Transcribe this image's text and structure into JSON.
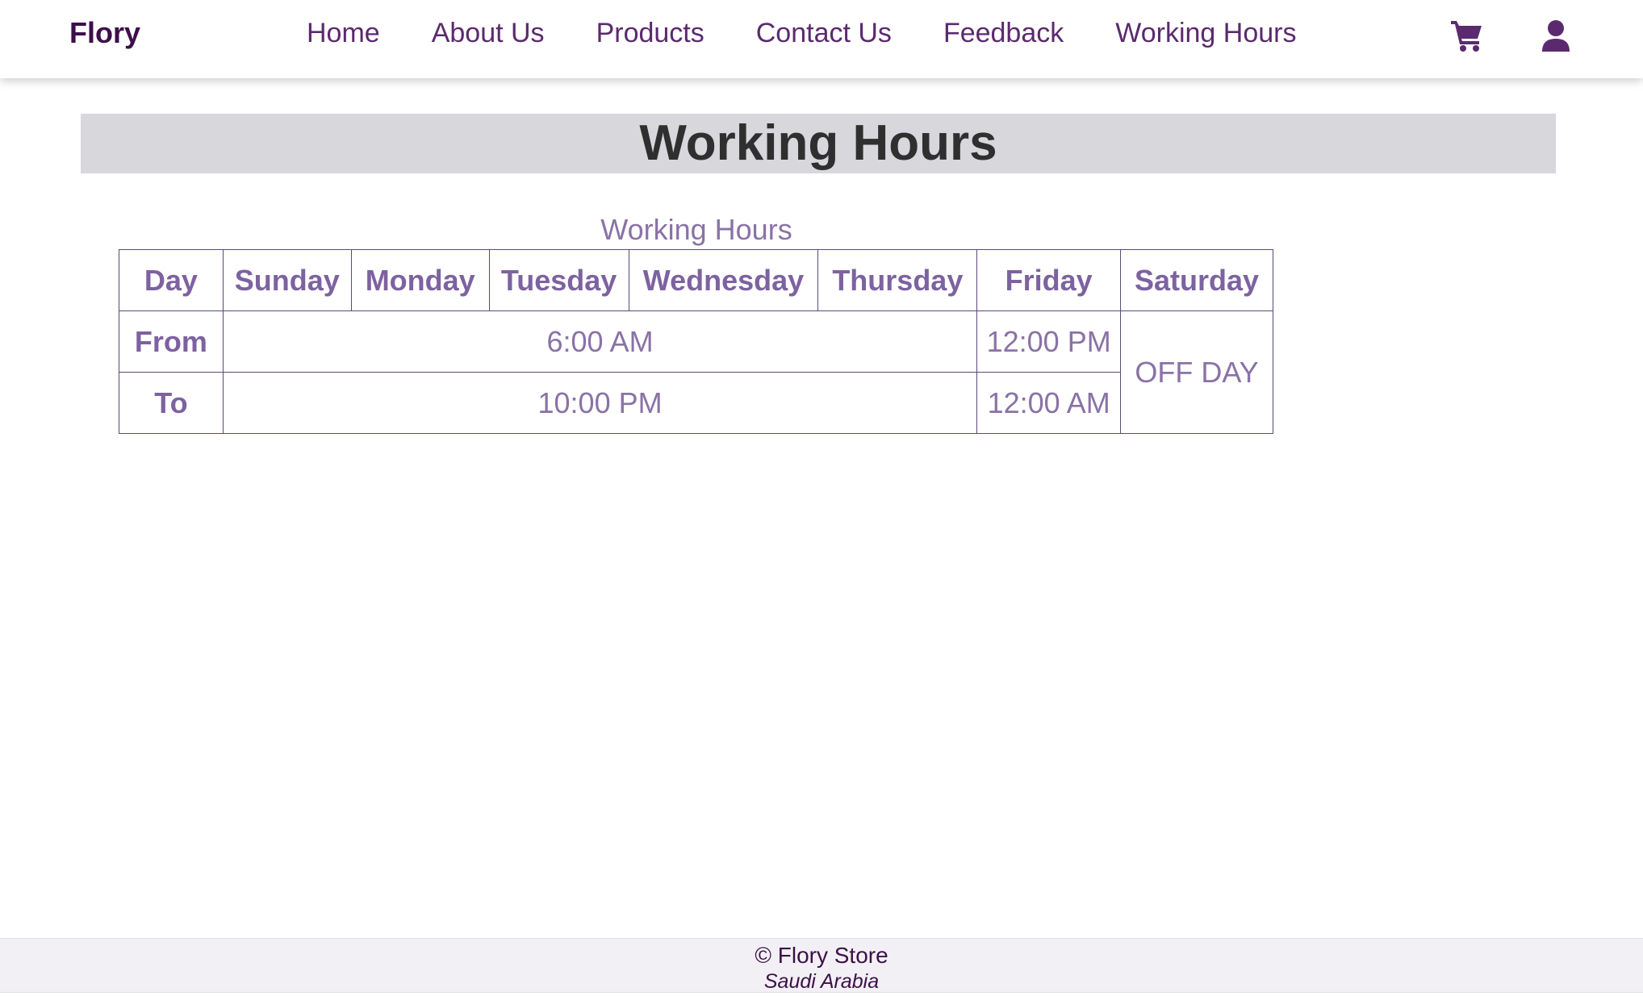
{
  "brand": "Flory",
  "nav": {
    "items": [
      "Home",
      "About Us",
      "Products",
      "Contact Us",
      "Feedback",
      "Working Hours"
    ],
    "icons": [
      "cart-icon",
      "user-icon"
    ]
  },
  "banner": {
    "title": "Working Hours"
  },
  "hours_table": {
    "caption": "Working Hours",
    "headers": [
      "Day",
      "Sunday",
      "Monday",
      "Tuesday",
      "Wednesday",
      "Thursday",
      "Friday",
      "Saturday"
    ],
    "rows": [
      {
        "label": "From",
        "weekdays": "6:00 AM",
        "friday": "12:00 PM"
      },
      {
        "label": "To",
        "weekdays": "10:00 PM",
        "friday": "12:00 AM"
      }
    ],
    "saturday": "OFF DAY"
  },
  "footer": {
    "copyright": "© Flory Store",
    "country": "Saudi Arabia"
  },
  "colors": {
    "brand": "#3d0f4a",
    "nav_text": "#5b2a6e",
    "table_text": "#7d62a0",
    "table_border": "#5a4a78",
    "banner_bg": "#d8d7dc"
  }
}
